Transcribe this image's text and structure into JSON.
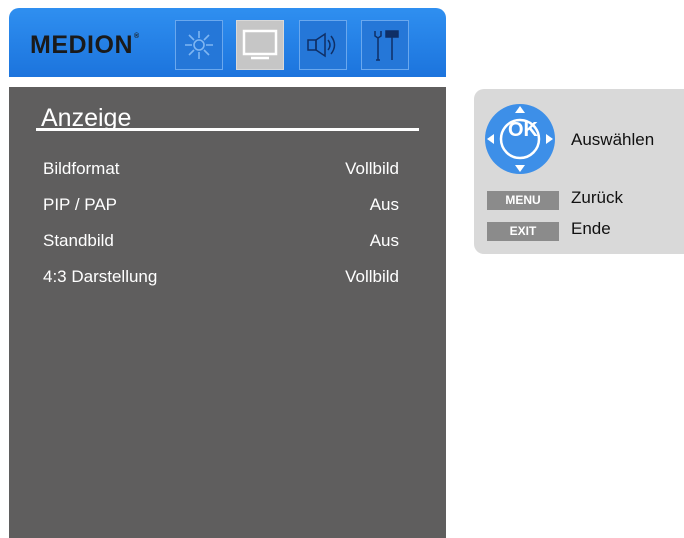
{
  "header": {
    "logo_text": "MEDION",
    "logo_mark": "®",
    "tabs": [
      {
        "icon": "picture-brightness-icon",
        "active": false
      },
      {
        "icon": "display-monitor-icon",
        "active": true
      },
      {
        "icon": "speaker-audio-icon",
        "active": false
      },
      {
        "icon": "tools-settings-icon",
        "active": false
      }
    ]
  },
  "menu": {
    "title": "Anzeige",
    "items": [
      {
        "label": "Bildformat",
        "value": "Vollbild"
      },
      {
        "label": "PIP / PAP",
        "value": "Aus"
      },
      {
        "label": "Standbild",
        "value": "Aus"
      },
      {
        "label": "4:3 Darstellung",
        "value": "Vollbild"
      }
    ]
  },
  "help": {
    "ok_label": "OK",
    "select_label": "Auswählen",
    "menu_key": "MENU",
    "back_label": "Zurück",
    "exit_key": "EXIT",
    "end_label": "Ende"
  },
  "colors": {
    "header_blue": "#1c74dd",
    "body_gray": "#5f5e5e",
    "help_panel": "#d9d9d9",
    "dpad_blue": "#3d8fe8",
    "key_gray": "#8b8b8b"
  }
}
